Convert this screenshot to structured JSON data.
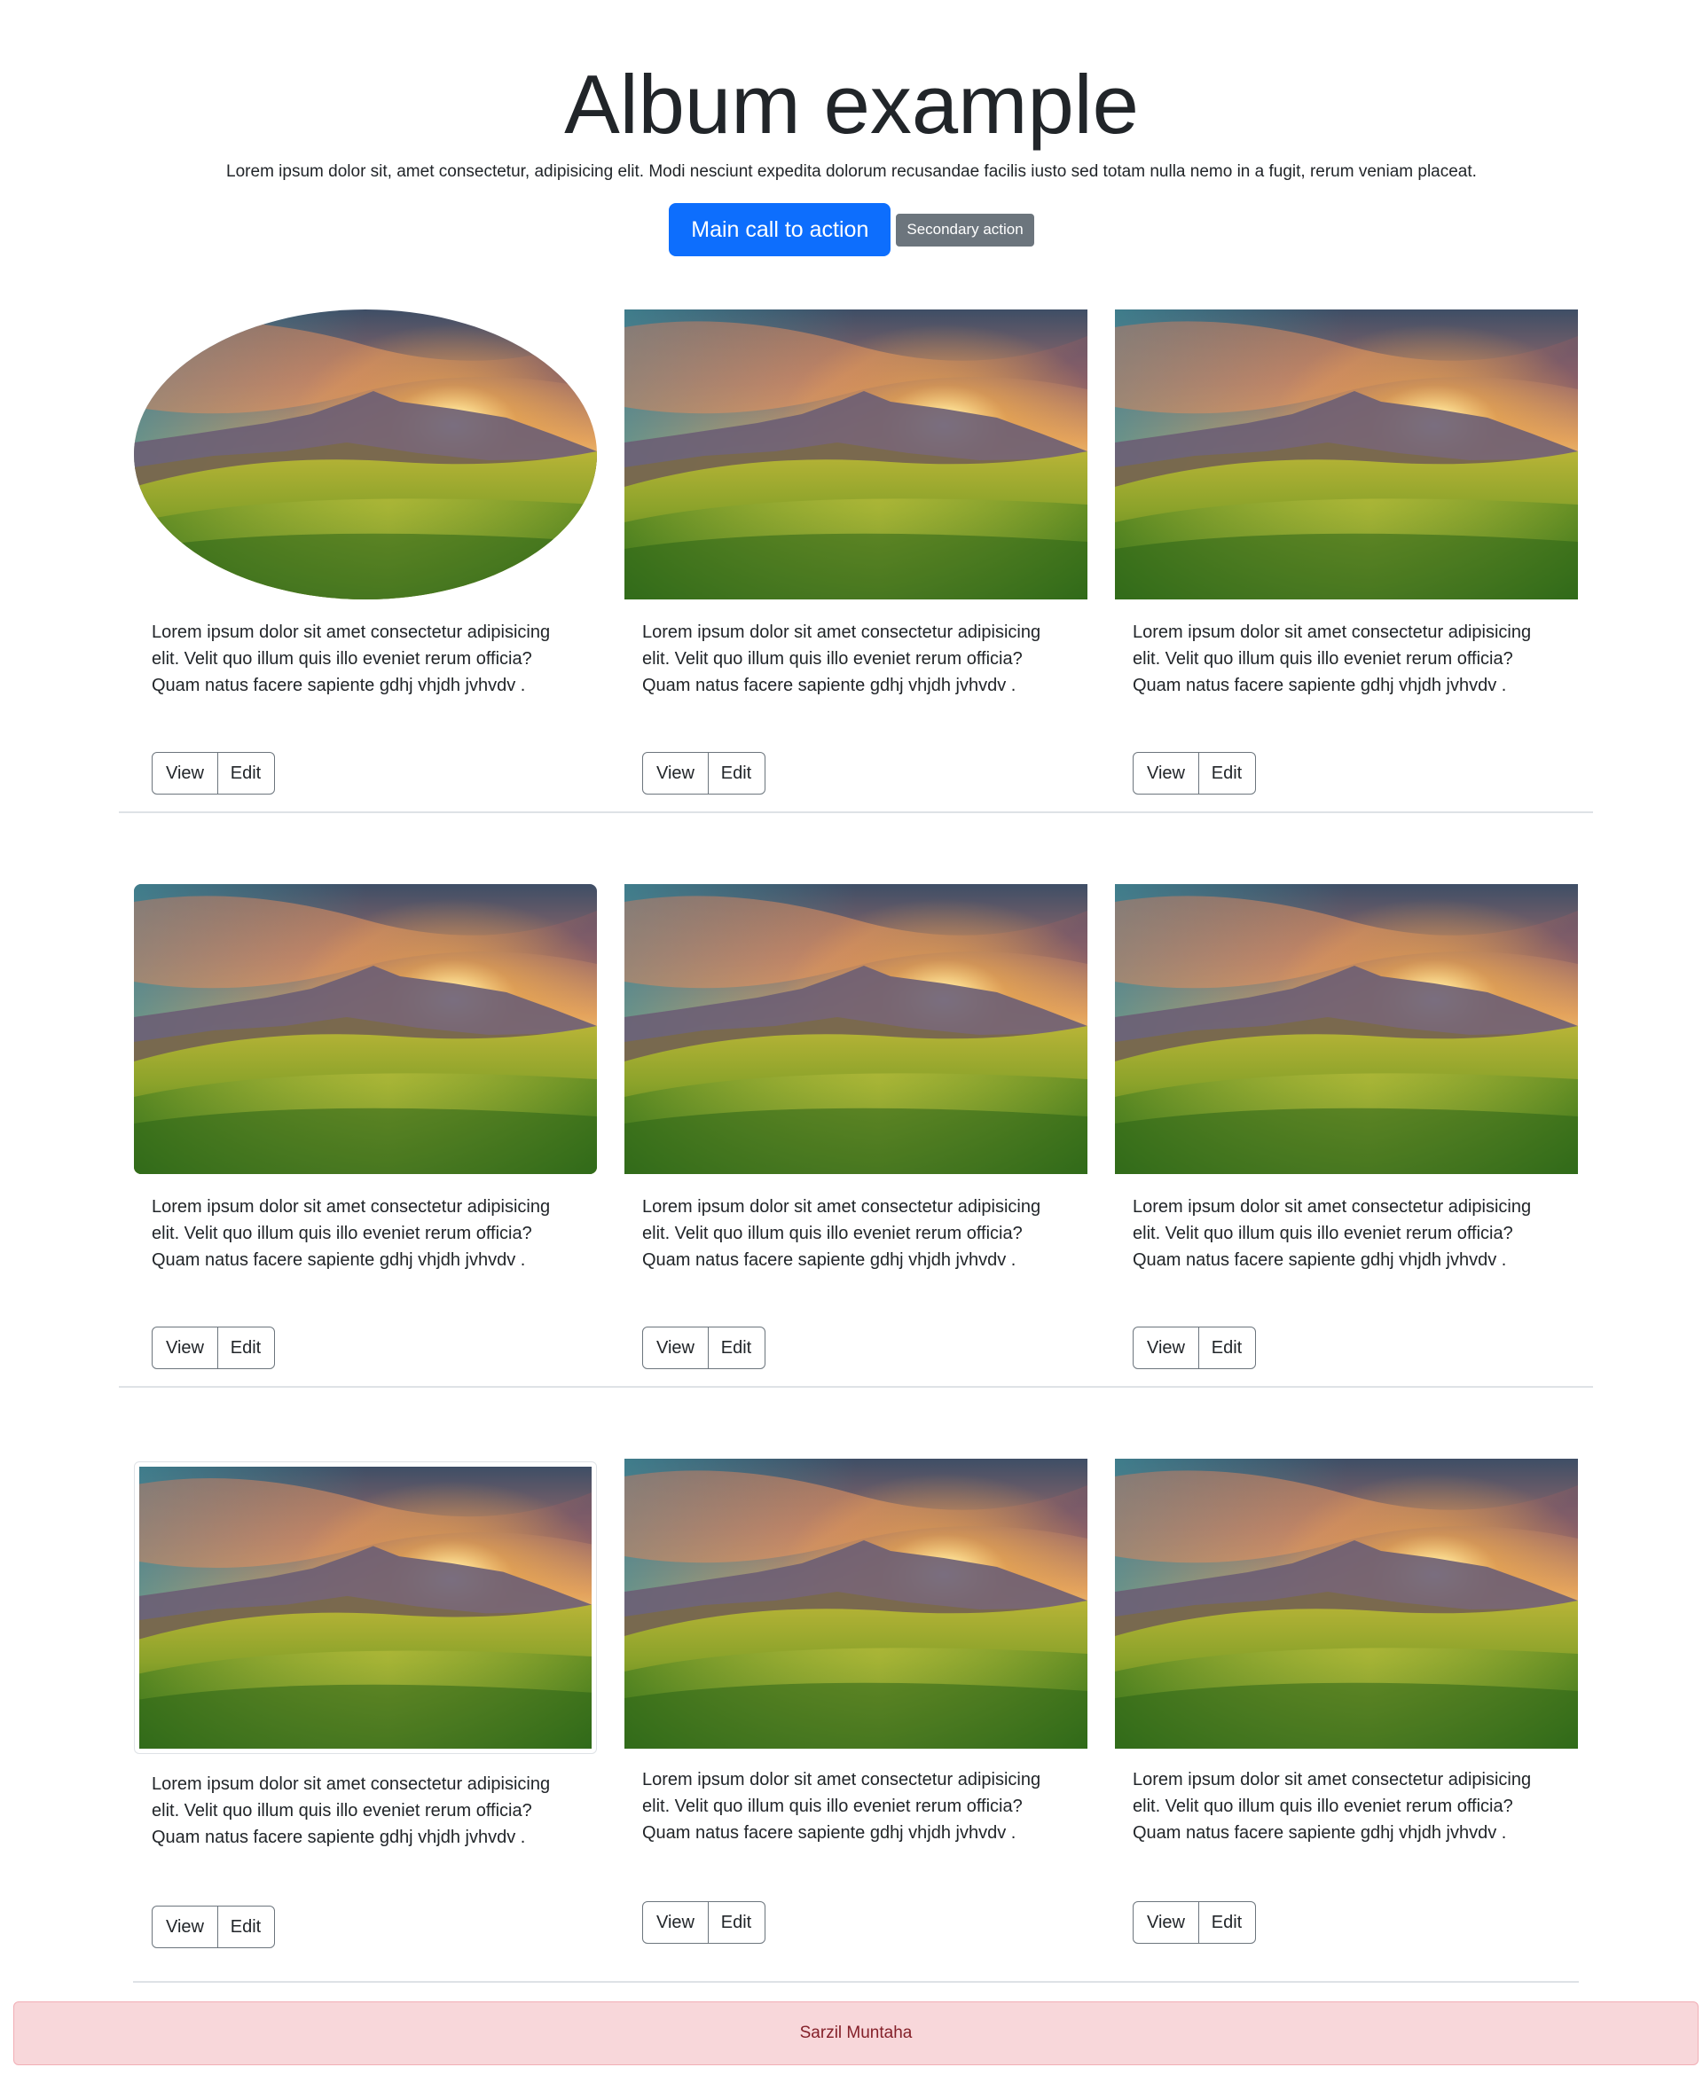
{
  "hero": {
    "title": "Album example",
    "lead": "Lorem ipsum dolor sit, amet consectetur, adipisicing elit. Modi nesciunt expedita dolorum recusandae facilis iusto sed totam nulla nemo in a fugit, rerum veniam placeat.",
    "primary_label": "Main call to action",
    "secondary_label": "Secondary action"
  },
  "cards": [
    {
      "text": "Lorem ipsum dolor sit amet consectetur adipisicing elit. Velit quo illum quis illo eveniet rerum officia? Quam natus facere sapiente gdhj vhjdh jvhvdv .",
      "view_label": "View",
      "edit_label": "Edit",
      "image_style": "oval"
    },
    {
      "text": "Lorem ipsum dolor sit amet consectetur adipisicing elit. Velit quo illum quis illo eveniet rerum officia? Quam natus facere sapiente gdhj vhjdh jvhvdv .",
      "view_label": "View",
      "edit_label": "Edit",
      "image_style": "square"
    },
    {
      "text": "Lorem ipsum dolor sit amet consectetur adipisicing elit. Velit quo illum quis illo eveniet rerum officia? Quam natus facere sapiente gdhj vhjdh jvhvdv .",
      "view_label": "View",
      "edit_label": "Edit",
      "image_style": "square"
    },
    {
      "text": "Lorem ipsum dolor sit amet consectetur adipisicing elit. Velit quo illum quis illo eveniet rerum officia? Quam natus facere sapiente gdhj vhjdh jvhvdv .",
      "view_label": "View",
      "edit_label": "Edit",
      "image_style": "rounded"
    },
    {
      "text": "Lorem ipsum dolor sit amet consectetur adipisicing elit. Velit quo illum quis illo eveniet rerum officia? Quam natus facere sapiente gdhj vhjdh jvhvdv .",
      "view_label": "View",
      "edit_label": "Edit",
      "image_style": "square"
    },
    {
      "text": "Lorem ipsum dolor sit amet consectetur adipisicing elit. Velit quo illum quis illo eveniet rerum officia? Quam natus facere sapiente gdhj vhjdh jvhvdv .",
      "view_label": "View",
      "edit_label": "Edit",
      "image_style": "square"
    },
    {
      "text": "Lorem ipsum dolor sit amet consectetur adipisicing elit. Velit quo illum quis illo eveniet rerum officia? Quam natus facere sapiente gdhj vhjdh jvhvdv .",
      "view_label": "View",
      "edit_label": "Edit",
      "image_style": "thumbnail"
    },
    {
      "text": "Lorem ipsum dolor sit amet consectetur adipisicing elit. Velit quo illum quis illo eveniet rerum officia? Quam natus facere sapiente gdhj vhjdh jvhvdv .",
      "view_label": "View",
      "edit_label": "Edit",
      "image_style": "square"
    },
    {
      "text": "Lorem ipsum dolor sit amet consectetur adipisicing elit. Velit quo illum quis illo eveniet rerum officia? Quam natus facere sapiente gdhj vhjdh jvhvdv .",
      "view_label": "View",
      "edit_label": "Edit",
      "image_style": "square"
    }
  ],
  "footer": {
    "text": "Sarzil Muntaha"
  },
  "colors": {
    "primary": "#0d6efd",
    "secondary": "#6c757d",
    "footer_bg": "#f8d7da",
    "footer_text": "#842029"
  }
}
